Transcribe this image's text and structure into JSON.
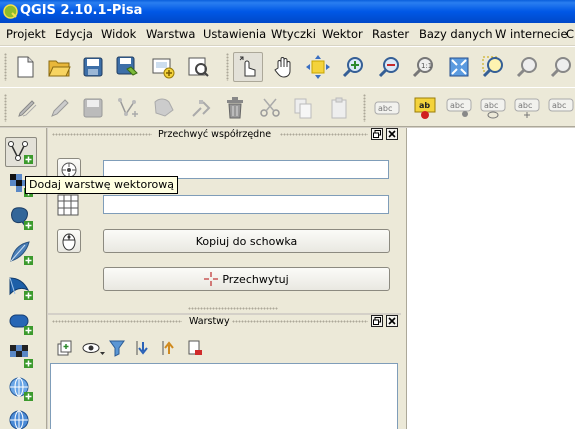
{
  "window": {
    "title": "QGIS 2.10.1-Pisa"
  },
  "menu": [
    "Projekt",
    "Edycja",
    "Widok",
    "Warstwa",
    "Ustawienia",
    "Wtyczki",
    "Wektor",
    "Raster",
    "Bazy danych",
    "W internecie",
    "C"
  ],
  "toolbar_file": [
    "new-project-icon",
    "open-project-icon",
    "save-project-icon",
    "save-as-icon",
    "new-print-composer-icon",
    "composer-manager-icon"
  ],
  "toolbar_navigation": [
    "touch-zoom-icon",
    "pan-icon",
    "pan-to-selection-icon",
    "zoom-in-icon",
    "zoom-out-icon",
    "zoom-actual-size-icon",
    "zoom-full-icon",
    "zoom-to-selection-icon",
    "zoom-to-layer-icon",
    "zoom-last-icon"
  ],
  "toolbar_digitizing": [
    "current-edits-icon",
    "toggle-editing-icon",
    "save-layer-edits-icon",
    "add-feature-icon",
    "move-feature-icon",
    "node-tool-icon",
    "delete-selected-icon",
    "cut-features-icon",
    "copy-features-icon",
    "paste-features-icon"
  ],
  "toolbar_labels": [
    "abc",
    "ab",
    "abc",
    "abc",
    "abc",
    "abc"
  ],
  "left_toolbar": [
    "add-vector-layer-icon",
    "add-raster-layer-icon",
    "add-postgis-layer-icon",
    "add-spatialite-layer-icon",
    "add-mssql-layer-icon",
    "add-oracle-layer-icon",
    "add-wms-layer-icon",
    "add-wcs-layer-icon",
    "add-wfs-layer-icon"
  ],
  "tooltip": {
    "text": "Dodaj warstwę wektorową"
  },
  "coord_panel": {
    "title": "Przechwyć współrzędne",
    "field1": "",
    "field2": "",
    "copy_button": "Kopiuj do schowka",
    "capture_button": "Przechwytuj"
  },
  "layers_panel": {
    "title": "Warstwy"
  },
  "colors": {
    "titlebar": "#0058e6",
    "tooltip_bg": "#ffffe1",
    "menu_bg": "#ece9d8"
  }
}
